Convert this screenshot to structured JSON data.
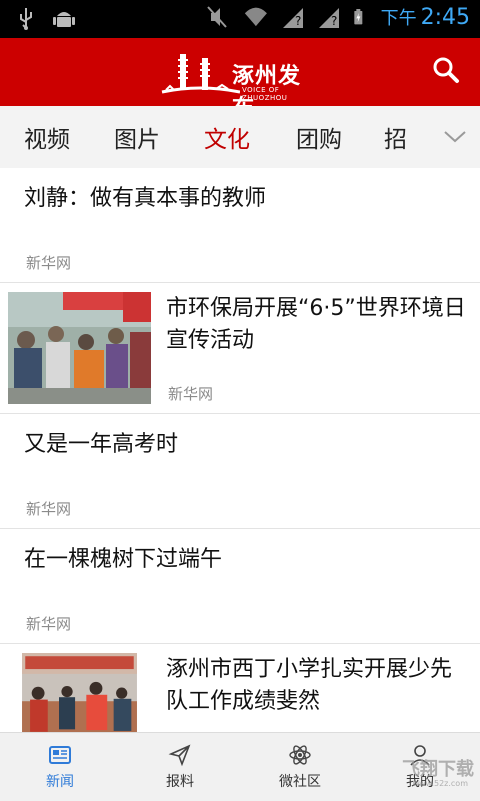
{
  "status_bar": {
    "time_prefix": "下午",
    "time": "2:45",
    "icons": [
      "usb-icon",
      "android-icon",
      "mute-icon",
      "wifi-icon",
      "unknown-notify-icon",
      "unknown-notify-icon",
      "battery-charging-icon"
    ]
  },
  "header": {
    "brand": "涿州发布",
    "subtitle": "VOICE OF ZHUOZHOU",
    "search_icon": "search-icon"
  },
  "tabs": {
    "items": [
      "视频",
      "图片",
      "文化",
      "团购",
      "招"
    ],
    "active": "文化",
    "more_icon": "chevron-down-icon"
  },
  "articles": [
    {
      "title": "刘静：做有真本事的教师",
      "source": "新华网",
      "has_image": false
    },
    {
      "title": "市环保局开展“6·5”世界环境日宣传活动",
      "source": "新华网",
      "has_image": true
    },
    {
      "title": "又是一年高考时",
      "source": "新华网",
      "has_image": false
    },
    {
      "title": "在一棵槐树下过端午",
      "source": "新华网",
      "has_image": false
    },
    {
      "title": "涿州市西丁小学扎实开展少先队工作成绩斐然",
      "source": "",
      "has_image": true
    }
  ],
  "bottom_nav": {
    "items": [
      {
        "label": "新闻",
        "icon": "newspaper-icon"
      },
      {
        "label": "报料",
        "icon": "send-icon"
      },
      {
        "label": "微社区",
        "icon": "atom-icon"
      },
      {
        "label": "我的",
        "icon": "user-icon"
      }
    ],
    "active": "新闻"
  },
  "watermark": {
    "text": "飞翔下载",
    "url": "www.52z.com"
  },
  "colors": {
    "brand_red": "#cc0000",
    "active_tab": "#c00000",
    "active_nav": "#2f7bd8",
    "status_time": "#3fa9f5"
  }
}
